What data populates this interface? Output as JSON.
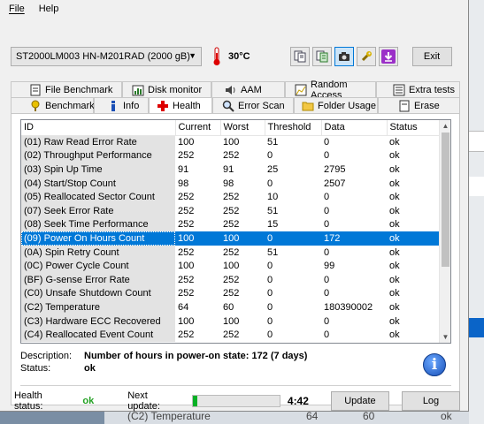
{
  "menu": {
    "file": "File",
    "help": "Help"
  },
  "drive": {
    "selected": "ST2000LM003 HN-M201RAD (2000 gB)"
  },
  "temperature": "30°C",
  "exit_label": "Exit",
  "tabs_top": [
    {
      "label": "File Benchmark",
      "icon": "file-benchmark-icon"
    },
    {
      "label": "Disk monitor",
      "icon": "disk-monitor-icon"
    },
    {
      "label": "AAM",
      "icon": "speaker-icon"
    },
    {
      "label": "Random Access",
      "icon": "random-access-icon"
    },
    {
      "label": "Extra tests",
      "icon": "extra-tests-icon"
    }
  ],
  "tabs_bottom": [
    {
      "label": "Benchmark",
      "icon": "benchmark-icon"
    },
    {
      "label": "Info",
      "icon": "info-icon"
    },
    {
      "label": "Health",
      "icon": "health-cross-icon"
    },
    {
      "label": "Error Scan",
      "icon": "magnifier-icon"
    },
    {
      "label": "Folder Usage",
      "icon": "folder-icon"
    },
    {
      "label": "Erase",
      "icon": "erase-icon"
    }
  ],
  "table": {
    "columns": [
      "ID",
      "Current",
      "Worst",
      "Threshold",
      "Data",
      "Status"
    ],
    "rows": [
      [
        "(01) Raw Read Error Rate",
        "100",
        "100",
        "51",
        "0",
        "ok"
      ],
      [
        "(02) Throughput Performance",
        "252",
        "252",
        "0",
        "0",
        "ok"
      ],
      [
        "(03) Spin Up Time",
        "91",
        "91",
        "25",
        "2795",
        "ok"
      ],
      [
        "(04) Start/Stop Count",
        "98",
        "98",
        "0",
        "2507",
        "ok"
      ],
      [
        "(05) Reallocated Sector Count",
        "252",
        "252",
        "10",
        "0",
        "ok"
      ],
      [
        "(07) Seek Error Rate",
        "252",
        "252",
        "51",
        "0",
        "ok"
      ],
      [
        "(08) Seek Time Performance",
        "252",
        "252",
        "15",
        "0",
        "ok"
      ],
      [
        "(09) Power On Hours Count",
        "100",
        "100",
        "0",
        "172",
        "ok"
      ],
      [
        "(0A) Spin Retry Count",
        "252",
        "252",
        "51",
        "0",
        "ok"
      ],
      [
        "(0C) Power Cycle Count",
        "100",
        "100",
        "0",
        "99",
        "ok"
      ],
      [
        "(BF) G-sense Error Rate",
        "252",
        "252",
        "0",
        "0",
        "ok"
      ],
      [
        "(C0) Unsafe Shutdown Count",
        "252",
        "252",
        "0",
        "0",
        "ok"
      ],
      [
        "(C2) Temperature",
        "64",
        "60",
        "0",
        "180390002",
        "ok"
      ],
      [
        "(C3) Hardware ECC Recovered",
        "100",
        "100",
        "0",
        "0",
        "ok"
      ],
      [
        "(C4) Reallocated Event Count",
        "252",
        "252",
        "0",
        "0",
        "ok"
      ]
    ],
    "selected_index": 7
  },
  "description": {
    "label": "Description:",
    "value": "Number of hours in power-on state: 172 (7 days)",
    "status_label": "Status:",
    "status_value": "ok"
  },
  "health": {
    "label": "Health status:",
    "value": "ok",
    "next_update_label": "Next update:",
    "progress_fraction": 0.05,
    "time": "4:42",
    "update_label": "Update",
    "log_label": "Log"
  },
  "background": {
    "peek_text": "(C2) Temperature",
    "peek_cur": "64",
    "peek_worst": "60",
    "peek_status": "ok"
  },
  "colors": {
    "selection": "#0078d7",
    "ok_green": "#22a022",
    "progress_green": "#06b025"
  }
}
